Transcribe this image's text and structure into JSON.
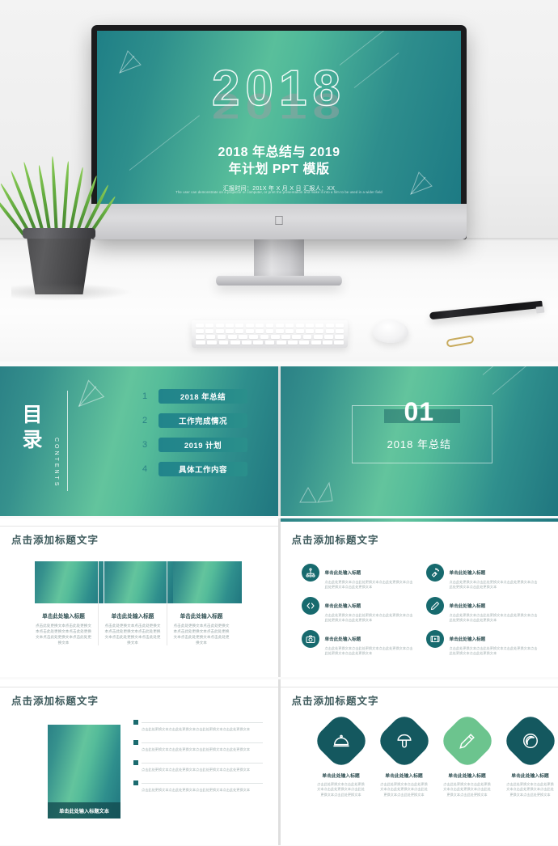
{
  "hero": {
    "big_year": "2018",
    "title_line1": "2018 年总结与 2019",
    "title_line2": "年计划 PPT 模版",
    "meta": "汇报时间：201X 年 X 月 X 日   汇报人：XX",
    "english_note": "The user can demonstrate on a projector or computer, or print the presentation and make it into a film to be used in a wider field"
  },
  "contents": {
    "vertical_title": "目录",
    "english_label": "CONTENTS",
    "items": [
      {
        "num": "1",
        "label": "2018 年总结"
      },
      {
        "num": "2",
        "label": "工作完成情况"
      },
      {
        "num": "3",
        "label": "2019 计划"
      },
      {
        "num": "4",
        "label": "具体工作内容"
      }
    ]
  },
  "section": {
    "number": "01",
    "subtitle": "2018 年总结"
  },
  "slide_cards": {
    "title": "点击添加标题文字",
    "cards": [
      {
        "heading": "单击此处输入标题",
        "body": "点击此处更换文本点击此处更换文本点击此处更换文本点击此处更换文本点击此处更换文本点击此处更换文本"
      },
      {
        "heading": "单击此处输入标题",
        "body": "点击此处更换文本点击此处更换文本点击此处更换文本点击此处更换文本点击此处更换文本点击此处更换文本"
      },
      {
        "heading": "单击此处输入标题",
        "body": "点击此处更换文本点击此处更换文本点击此处更换文本点击此处更换文本点击此处更换文本点击此处更换文本"
      }
    ]
  },
  "slide_icons": {
    "title": "点击添加标题文字",
    "items": [
      {
        "icon": "org-chart-icon",
        "heading": "单击此处输入标题",
        "body": "点击此处更换文本点击此处更换文本点击此处更换文本点击此处更换文本点击此处更换文本"
      },
      {
        "icon": "spray-can-icon",
        "heading": "单击此处输入标题",
        "body": "点击此处更换文本点击此处更换文本点击此处更换文本点击此处更换文本点击此处更换文本"
      },
      {
        "icon": "code-brackets-icon",
        "heading": "单击此处输入标题",
        "body": "点击此处更换文本点击此处更换文本点击此处更换文本点击此处更换文本点击此处更换文本"
      },
      {
        "icon": "pencil-icon",
        "heading": "单击此处输入标题",
        "body": "点击此处更换文本点击此处更换文本点击此处更换文本点击此处更换文本点击此处更换文本"
      },
      {
        "icon": "camera-icon",
        "heading": "单击此处输入标题",
        "body": "点击此处更换文本点击此处更换文本点击此处更换文本点击此处更换文本点击此处更换文本"
      },
      {
        "icon": "film-icon",
        "heading": "单击此处输入标题",
        "body": "点击此处更换文本点击此处更换文本点击此处更换文本点击此处更换文本点击此处更换文本"
      }
    ]
  },
  "slide_doc": {
    "title": "点击添加标题文字",
    "image_caption": "单击此处输入标题文本",
    "bullets": [
      {
        "body": "点击此处更换文本点击此处更换文本点击此处更换文本点击此处更换文本"
      },
      {
        "body": "点击此处更换文本点击此处更换文本点击此处更换文本点击此处更换文本"
      },
      {
        "body": "点击此处更换文本点击此处更换文本点击此处更换文本点击此处更换文本"
      },
      {
        "body": "点击此处更换文本点击此处更换文本点击此处更换文本点击此处更换文本"
      }
    ]
  },
  "slide_diamonds": {
    "title": "点击添加标题文字",
    "accent_dark": "#14585f",
    "accent_light": "#6cc48e",
    "items": [
      {
        "icon": "food-cloche-icon",
        "heading": "单击此处输入标题",
        "body": "点击此处更换文本点击此处更换文本点击此处更换文本点击此处更换文本点击此处更换文本"
      },
      {
        "icon": "mushroom-icon",
        "heading": "单击此处输入标题",
        "body": "点击此处更换文本点击此处更换文本点击此处更换文本点击此处更换文本点击此处更换文本"
      },
      {
        "icon": "pencil-icon",
        "heading": "单击此处输入标题",
        "body": "点击此处更换文本点击此处更换文本点击此处更换文本点击此处更换文本点击此处更换文本"
      },
      {
        "icon": "swirl-circle-icon",
        "heading": "单击此处输入标题",
        "body": "点击此处更换文本点击此处更换文本点击此处更换文本点击此处更换文本点击此处更换文本"
      }
    ]
  }
}
